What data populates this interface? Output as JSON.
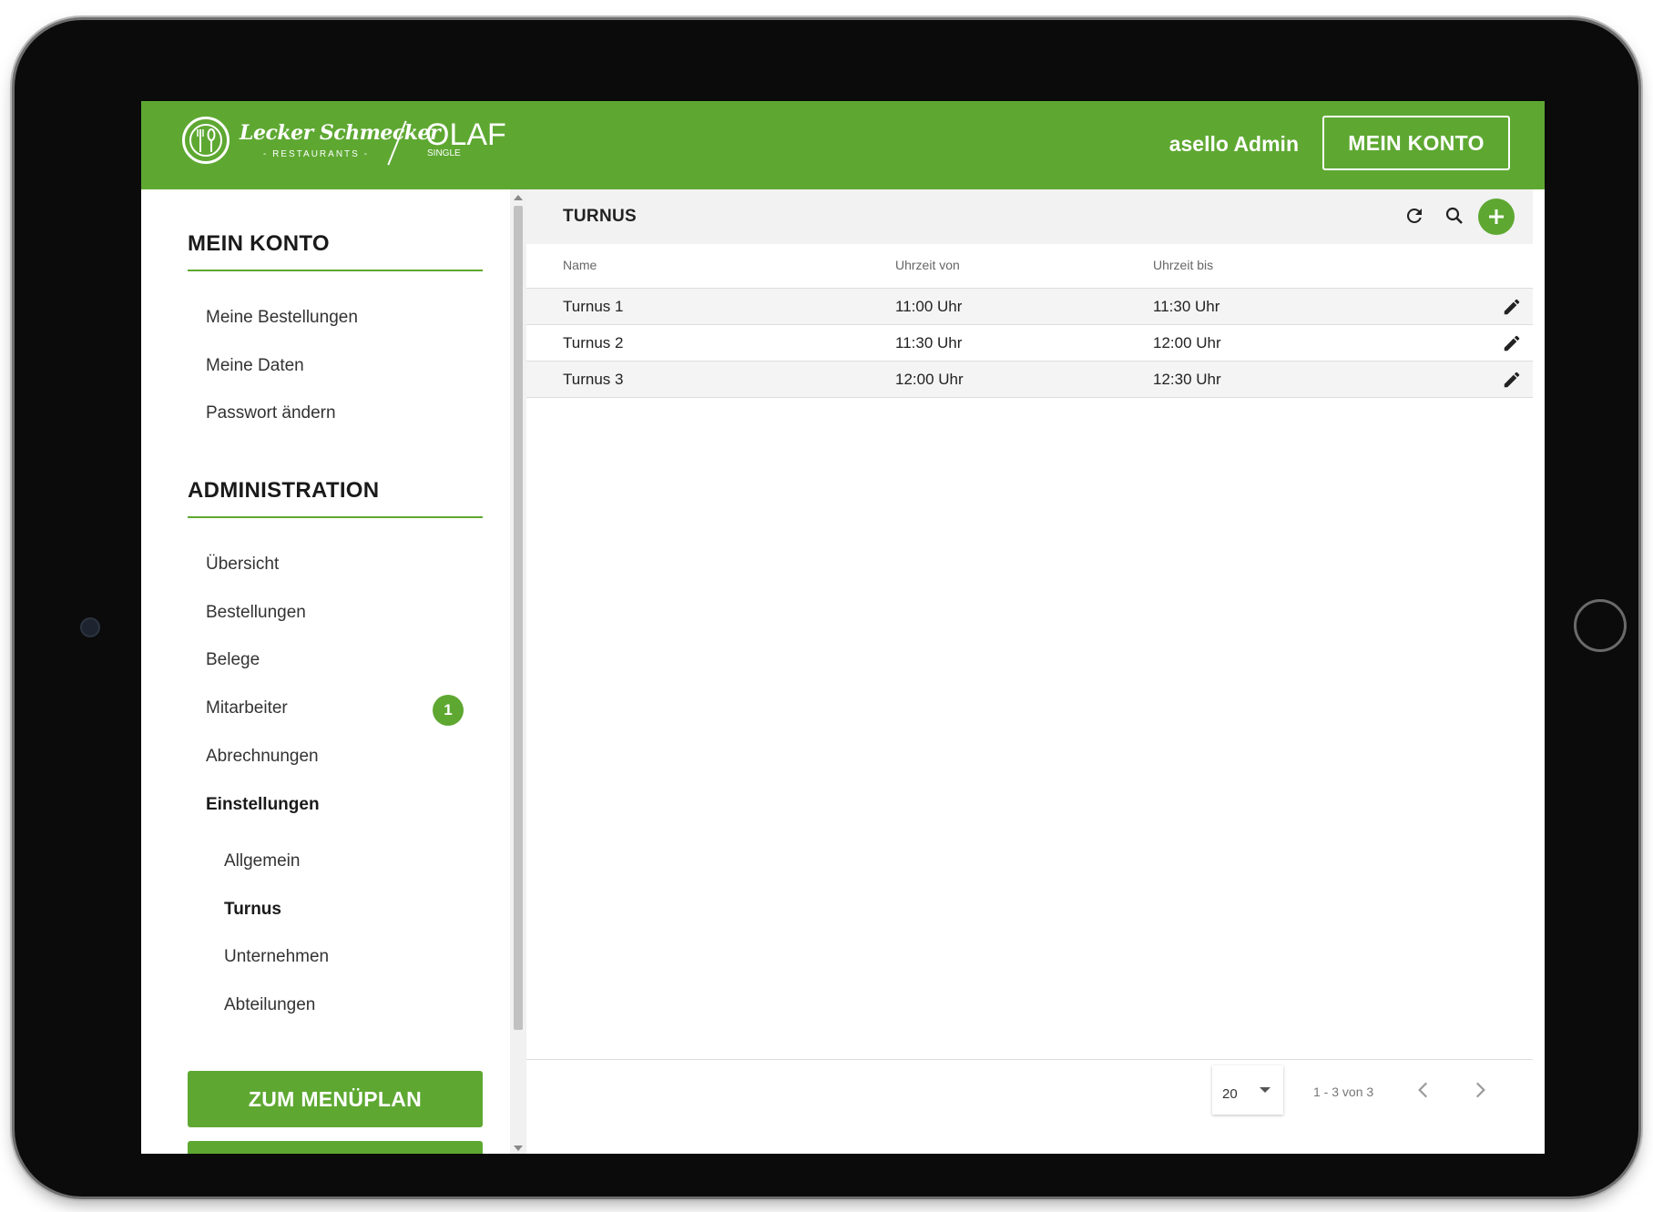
{
  "header": {
    "brand_name": "Lecker Schmecker",
    "brand_sub": "- RESTAURANTS -",
    "product_name": "OLAF",
    "product_sub": "SINGLE",
    "user_name": "asello Admin",
    "account_button": "MEIN KONTO"
  },
  "sidebar": {
    "section_account": "MEIN KONTO",
    "account_items": [
      {
        "label": "Meine Bestellungen"
      },
      {
        "label": "Meine Daten"
      },
      {
        "label": "Passwort ändern"
      }
    ],
    "section_admin": "ADMINISTRATION",
    "admin_items": [
      {
        "label": "Übersicht"
      },
      {
        "label": "Bestellungen"
      },
      {
        "label": "Belege"
      },
      {
        "label": "Mitarbeiter",
        "badge": "1"
      },
      {
        "label": "Abrechnungen"
      },
      {
        "label": "Einstellungen",
        "active": true
      }
    ],
    "settings_items": [
      {
        "label": "Allgemein"
      },
      {
        "label": "Turnus",
        "active": true
      },
      {
        "label": "Unternehmen"
      },
      {
        "label": "Abteilungen"
      }
    ],
    "menu_button": "ZUM MENÜPLAN"
  },
  "main": {
    "title": "TURNUS",
    "columns": [
      "Name",
      "Uhrzeit von",
      "Uhrzeit bis"
    ],
    "rows": [
      {
        "name": "Turnus 1",
        "from": "11:00 Uhr",
        "to": "11:30 Uhr"
      },
      {
        "name": "Turnus 2",
        "from": "11:30 Uhr",
        "to": "12:00 Uhr"
      },
      {
        "name": "Turnus 3",
        "from": "12:00 Uhr",
        "to": "12:30 Uhr"
      }
    ],
    "pagination": {
      "page_size": "20",
      "range": "1 - 3 von 3"
    }
  },
  "colors": {
    "accent": "#5ea832",
    "header_bg": "#f2f2f2"
  }
}
